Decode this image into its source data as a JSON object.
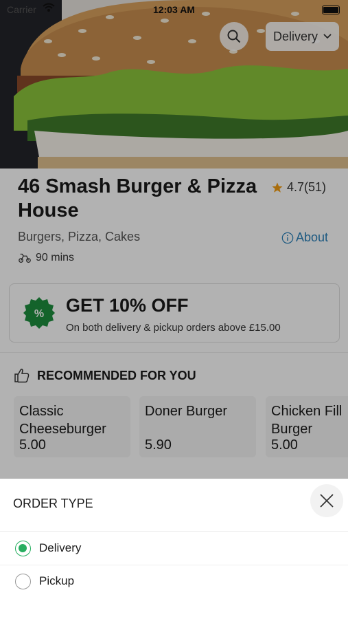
{
  "status": {
    "carrier": "Carrier",
    "time": "12:03 AM"
  },
  "header": {
    "order_type_label": "Delivery"
  },
  "restaurant": {
    "name": "46 Smash Burger & Pizza House",
    "rating": "4.7(51)",
    "cuisines": "Burgers, Pizza, Cakes",
    "about_label": "About",
    "delivery_time": "90 mins"
  },
  "promo": {
    "title": "GET 10% OFF",
    "subtitle": "On both delivery & pickup orders above £15.00",
    "badge_text": "%"
  },
  "recommended": {
    "heading": "RECOMMENDED FOR YOU",
    "items": [
      {
        "name": "Classic\nCheeseburger",
        "price": "5.00"
      },
      {
        "name": "Doner Burger",
        "price": "5.90"
      },
      {
        "name": "Chicken Fill\nBurger",
        "price": "5.00"
      }
    ]
  },
  "sheet": {
    "title": "ORDER TYPE",
    "options": [
      {
        "label": "Delivery",
        "selected": true
      },
      {
        "label": "Pickup",
        "selected": false
      }
    ]
  },
  "colors": {
    "accent": "#27ae60",
    "link": "#2980b9",
    "star": "#f39c12"
  }
}
